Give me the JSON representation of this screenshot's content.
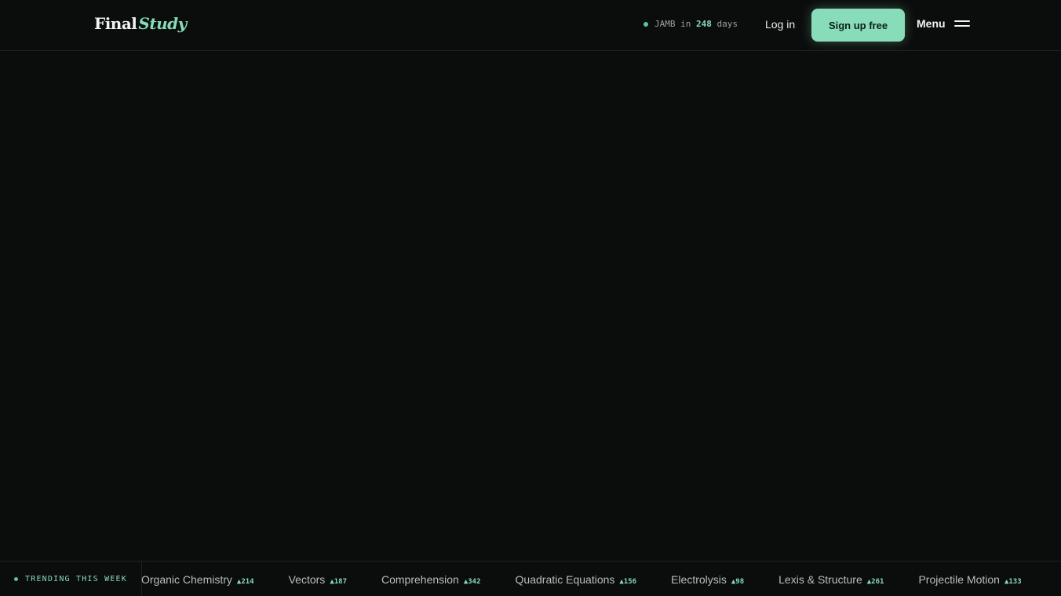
{
  "header": {
    "logo_main": "Final",
    "logo_accent": "Study",
    "countdown": {
      "prefix": "JAMB in",
      "days": "248",
      "suffix": "days"
    },
    "login_label": "Log in",
    "signup_label": "Sign up free",
    "menu_label": "Menu"
  },
  "ticker": {
    "label": "TRENDING THIS WEEK",
    "items": [
      {
        "topic": "Organic Chemistry",
        "count": "▲214"
      },
      {
        "topic": "Vectors",
        "count": "▲187"
      },
      {
        "topic": "Comprehension",
        "count": "▲342"
      },
      {
        "topic": "Quadratic Equations",
        "count": "▲156"
      },
      {
        "topic": "Electrolysis",
        "count": "▲98"
      },
      {
        "topic": "Lexis & Structure",
        "count": "▲261"
      },
      {
        "topic": "Projectile Motion",
        "count": "▲133"
      }
    ]
  },
  "colors": {
    "background": "#0b0d0c",
    "accent": "#86dcb9",
    "border": "#1e2321"
  }
}
